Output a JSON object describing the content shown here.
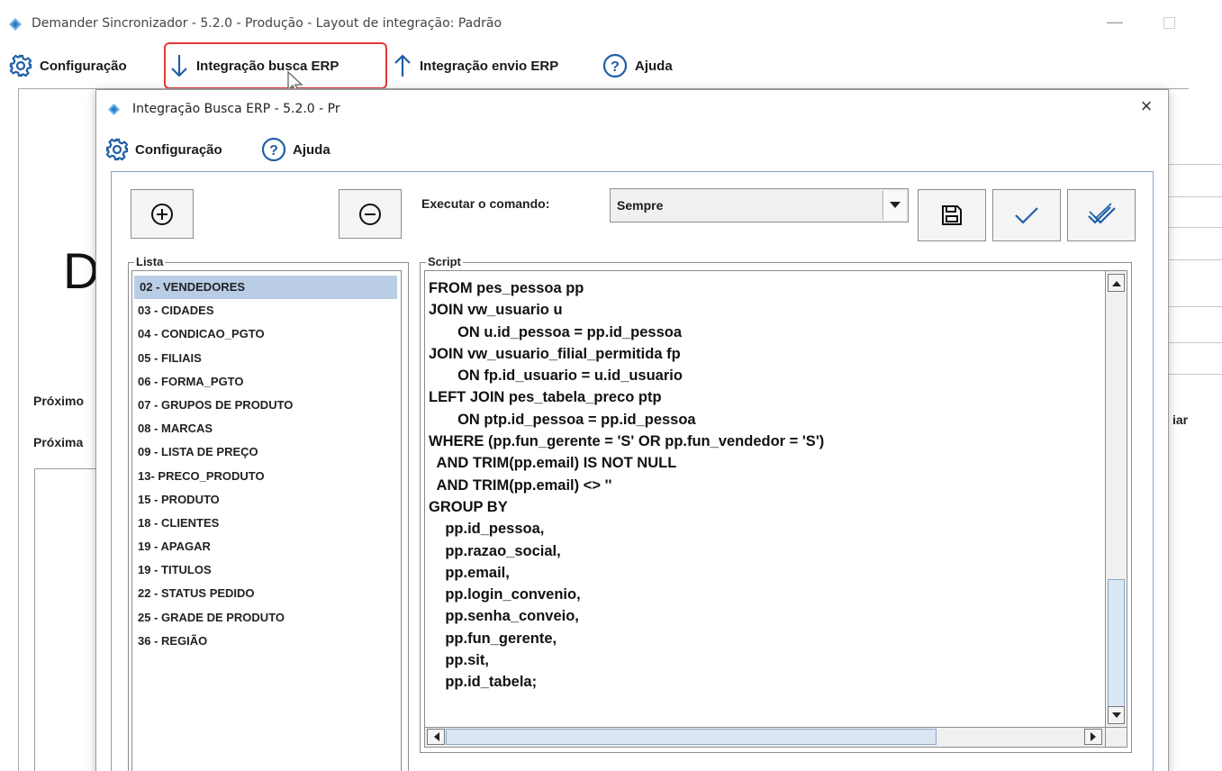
{
  "window": {
    "title": "Demander Sincronizador - 5.2.0 - Produção - Layout de integração: Padrão",
    "minimize": "—"
  },
  "main_menu": {
    "config": "Configuração",
    "busca": "Integração busca ERP",
    "envio": "Integração envio ERP",
    "ajuda": "Ajuda"
  },
  "background": {
    "big_letter": "D",
    "label1": "Próximo",
    "label2": "Próxima",
    "right_label": "iar"
  },
  "dialog": {
    "title": "Integração Busca ERP - 5.2.0 - Pr",
    "close": "×",
    "menu": {
      "config": "Configuração",
      "ajuda": "Ajuda"
    },
    "exec_label": "Executar o comando:",
    "exec_value": "Sempre",
    "list_legend": "Lista",
    "script_legend": "Script",
    "list_items": [
      "02 - VENDEDORES",
      "03 - CIDADES",
      "04 - CONDICAO_PGTO",
      "05 - FILIAIS",
      "06 - FORMA_PGTO",
      "07 - GRUPOS DE PRODUTO",
      "08 - MARCAS",
      "09 - LISTA DE PREÇO",
      "13- PRECO_PRODUTO",
      "15 - PRODUTO",
      "18 - CLIENTES",
      "19 - APAGAR",
      "19 - TITULOS",
      "22 - STATUS PEDIDO",
      "25 - GRADE DE PRODUTO",
      "36 - REGIÃO"
    ],
    "selected_item": "02 - VENDEDORES",
    "script": "FROM pes_pessoa pp\nJOIN vw_usuario u\n       ON u.id_pessoa = pp.id_pessoa\nJOIN vw_usuario_filial_permitida fp\n       ON fp.id_usuario = u.id_usuario\nLEFT JOIN pes_tabela_preco ptp\n       ON ptp.id_pessoa = pp.id_pessoa\nWHERE (pp.fun_gerente = 'S' OR pp.fun_vendedor = 'S')\n  AND TRIM(pp.email) IS NOT NULL\n  AND TRIM(pp.email) <> ''\nGROUP BY\n    pp.id_pessoa,\n    pp.razao_social,\n    pp.email,\n    pp.login_convenio,\n    pp.senha_conveio,\n    pp.fun_gerente,\n    pp.sit,\n    pp.id_tabela;"
  },
  "colors": {
    "highlight": "#e53935",
    "icon_blue": "#1f5fa8",
    "selection": "#b9cee6",
    "panel_border": "#7fa4c8"
  }
}
